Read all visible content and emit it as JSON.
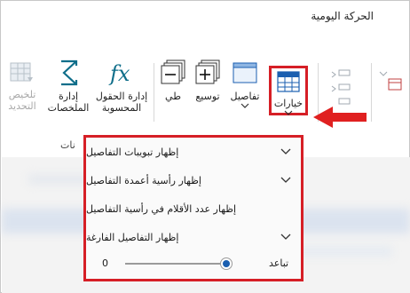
{
  "window": {
    "title": "الحركة اليومية"
  },
  "ribbon": {
    "options_label": "خيارات",
    "details_label": "تفاصيل",
    "expand_label": "توسيع",
    "collapse_label": "طي",
    "calc_fields_line1": "إدارة الحقول",
    "calc_fields_line2": "المحسوبة",
    "summaries_line1": "إدارة",
    "summaries_line2": "الملخصات",
    "update_summary_line1": "تلخيص",
    "update_summary_line2": "التحديد",
    "group_label_fragment": "نات"
  },
  "menu": {
    "items": [
      {
        "label": "إظهار تبويبات التفاصيل"
      },
      {
        "label": "إظهار رأسية أعمدة التفاصيل"
      },
      {
        "label": "إظهار عدد الأقلام في رأسية التفاصيل"
      },
      {
        "label": "إظهار التفاصيل الفارغة"
      }
    ],
    "slider": {
      "label": "تباعد",
      "value": "0",
      "level": 1.0
    }
  },
  "colors": {
    "highlight": "#d61f26",
    "accent": "#1b5fb0",
    "icon_teal": "#0f6e8a"
  }
}
